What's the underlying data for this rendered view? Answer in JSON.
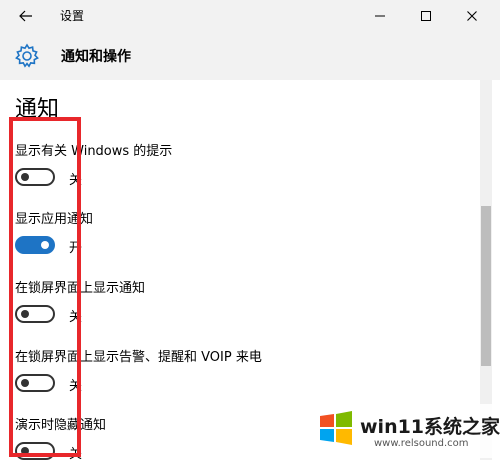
{
  "titlebar": {
    "title": "设置",
    "back_icon": "arrow-left-icon",
    "minimize_icon": "minimize-icon",
    "maximize_icon": "maximize-icon",
    "close_icon": "close-icon"
  },
  "header": {
    "icon": "gear-icon",
    "title": "通知和操作"
  },
  "section": {
    "title": "通知"
  },
  "settings": [
    {
      "label": "显示有关 Windows 的提示",
      "state": "关",
      "on": false
    },
    {
      "label": "显示应用通知",
      "state": "开",
      "on": true
    },
    {
      "label": "在锁屏界面上显示通知",
      "state": "关",
      "on": false
    },
    {
      "label": "在锁屏界面上显示告警、提醒和 VOIP 来电",
      "state": "关",
      "on": false
    },
    {
      "label": "演示时隐藏通知",
      "state": "关",
      "on": false
    }
  ],
  "colors": {
    "accent": "#1e74c5",
    "highlight": "#e8272b",
    "chrome": "#f2f2f2"
  },
  "watermark": {
    "title": "win11系统之家",
    "url": "www.relsound.com"
  }
}
